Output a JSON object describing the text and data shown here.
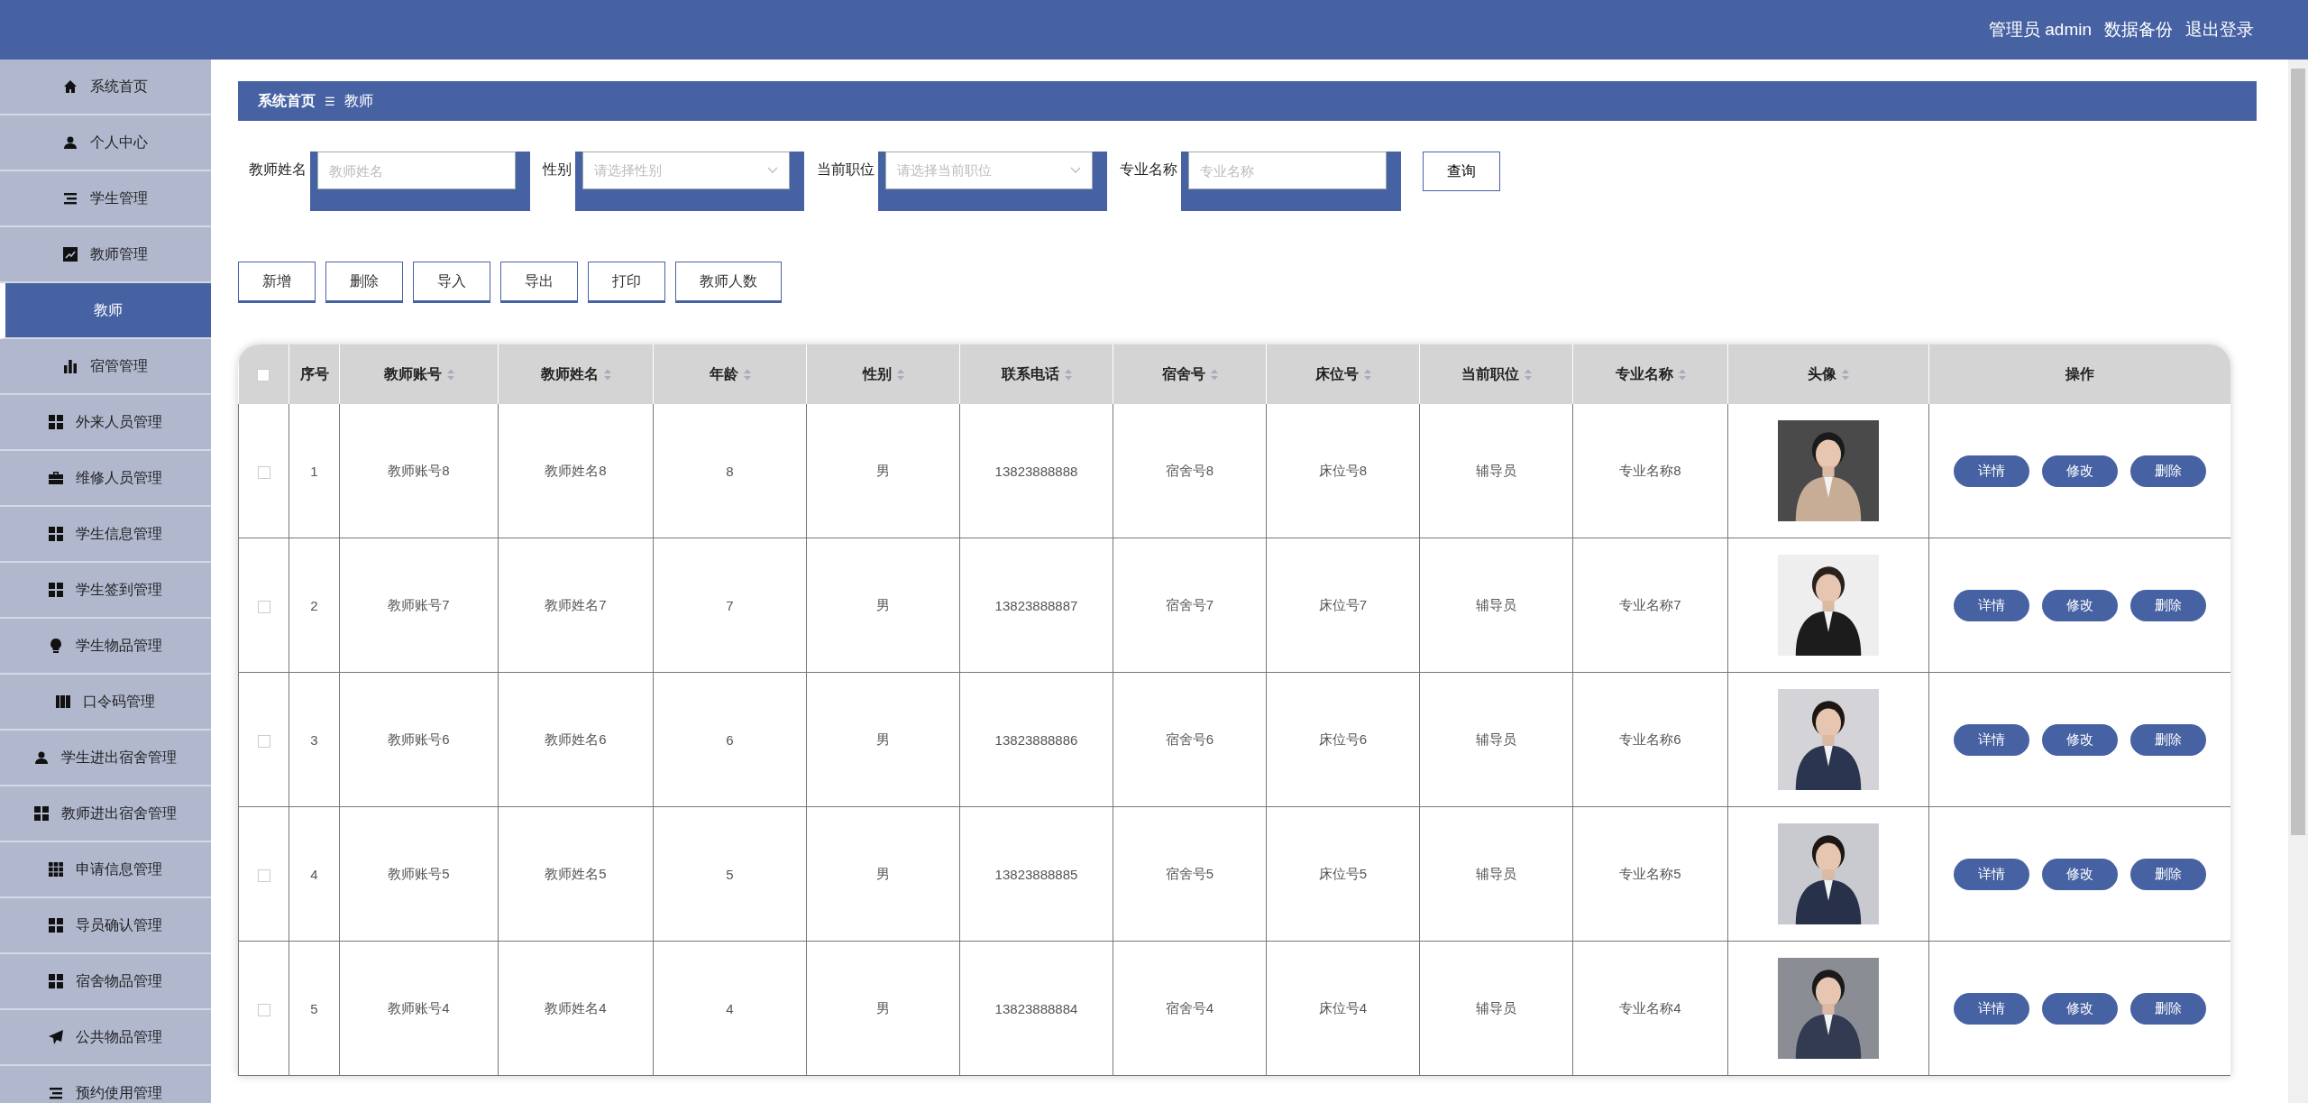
{
  "header": {
    "user_label": "管理员 admin",
    "links": [
      "数据备份",
      "退出登录"
    ]
  },
  "sidebar": {
    "items": [
      {
        "label": "系统首页",
        "selected": false
      },
      {
        "label": "个人中心",
        "selected": false
      },
      {
        "label": "学生管理",
        "selected": false
      },
      {
        "label": "教师管理",
        "selected": false
      },
      {
        "label": "教师",
        "selected": true
      },
      {
        "label": "宿管管理",
        "selected": false
      },
      {
        "label": "外来人员管理",
        "selected": false
      },
      {
        "label": "维修人员管理",
        "selected": false
      },
      {
        "label": "学生信息管理",
        "selected": false
      },
      {
        "label": "学生签到管理",
        "selected": false
      },
      {
        "label": "学生物品管理",
        "selected": false
      },
      {
        "label": "口令码管理",
        "selected": false
      },
      {
        "label": "学生进出宿舍管理",
        "selected": false
      },
      {
        "label": "教师进出宿舍管理",
        "selected": false
      },
      {
        "label": "申请信息管理",
        "selected": false
      },
      {
        "label": "导员确认管理",
        "selected": false
      },
      {
        "label": "宿舍物品管理",
        "selected": false
      },
      {
        "label": "公共物品管理",
        "selected": false
      },
      {
        "label": "预约使用管理",
        "selected": false
      }
    ]
  },
  "breadcrumb": {
    "items": [
      "系统首页",
      "教师"
    ],
    "separator": "☰"
  },
  "search": {
    "fields": [
      {
        "label": "教师姓名",
        "kind": "input",
        "placeholder": "教师姓名"
      },
      {
        "label": "性别",
        "kind": "select",
        "placeholder": "请选择性别"
      },
      {
        "label": "当前职位",
        "kind": "select",
        "placeholder": "请选择当前职位"
      },
      {
        "label": "专业名称",
        "kind": "input",
        "placeholder": "专业名称"
      }
    ],
    "button": "查询"
  },
  "actions": [
    "新增",
    "删除",
    "导入",
    "导出",
    "打印",
    "教师人数"
  ],
  "table": {
    "select_all_checked": false,
    "columns": [
      {
        "label": "序号",
        "sortable": false
      },
      {
        "label": "教师账号",
        "sortable": true
      },
      {
        "label": "教师姓名",
        "sortable": true
      },
      {
        "label": "年龄",
        "sortable": true
      },
      {
        "label": "性别",
        "sortable": true
      },
      {
        "label": "联系电话",
        "sortable": true
      },
      {
        "label": "宿舍号",
        "sortable": true
      },
      {
        "label": "床位号",
        "sortable": true
      },
      {
        "label": "当前职位",
        "sortable": true
      },
      {
        "label": "专业名称",
        "sortable": true
      },
      {
        "label": "头像",
        "sortable": true
      },
      {
        "label": "操作",
        "sortable": false
      }
    ],
    "rows": [
      {
        "checked": false,
        "cells": [
          "1",
          "教师账号8",
          "教师姓名8",
          "8",
          "男",
          "13823888888",
          "宿舍号8",
          "床位号8",
          "辅导员",
          "专业名称8"
        ],
        "photo": {
          "kind": "picture"
        },
        "buttons": [
          "详情",
          "修改",
          "删除"
        ]
      },
      {
        "checked": false,
        "cells": [
          "2",
          "教师账号7",
          "教师姓名7",
          "7",
          "男",
          "13823888887",
          "宿舍号7",
          "床位号7",
          "辅导员",
          "专业名称7"
        ],
        "photo": {
          "kind": "picture"
        },
        "buttons": [
          "详情",
          "修改",
          "删除"
        ]
      },
      {
        "checked": false,
        "cells": [
          "3",
          "教师账号6",
          "教师姓名6",
          "6",
          "男",
          "13823888886",
          "宿舍号6",
          "床位号6",
          "辅导员",
          "专业名称6"
        ],
        "photo": {
          "kind": "picture"
        },
        "buttons": [
          "详情",
          "修改",
          "删除"
        ]
      },
      {
        "checked": false,
        "cells": [
          "4",
          "教师账号5",
          "教师姓名5",
          "5",
          "男",
          "13823888885",
          "宿舍号5",
          "床位号5",
          "辅导员",
          "专业名称5"
        ],
        "photo": {
          "kind": "picture"
        },
        "buttons": [
          "详情",
          "修改",
          "删除"
        ]
      },
      {
        "checked": false,
        "cells": [
          "5",
          "教师账号4",
          "教师姓名4",
          "4",
          "男",
          "13823888884",
          "宿舍号4",
          "床位号4",
          "辅导员",
          "专业名称4"
        ],
        "photo": {
          "kind": "picture"
        },
        "buttons": [
          "详情",
          "修改",
          "删除"
        ]
      }
    ]
  }
}
